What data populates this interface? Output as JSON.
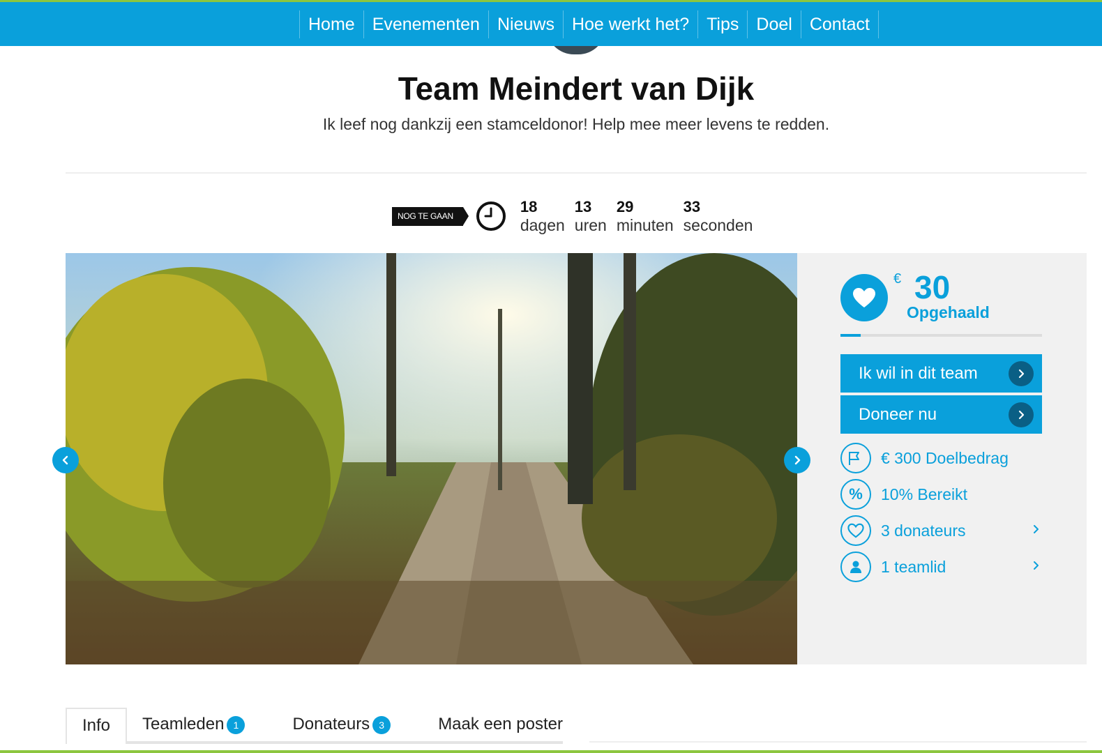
{
  "nav": {
    "items": [
      "Home",
      "Evenementen",
      "Nieuws",
      "Hoe werkt het?",
      "Tips",
      "Doel",
      "Contact"
    ]
  },
  "team": {
    "title": "Team Meindert van Dijk",
    "subtitle": "Ik leef nog dankzij een stamceldonor! Help mee meer levens te redden."
  },
  "countdown": {
    "badge": "NOG TE GAAN",
    "units": [
      {
        "value": "18",
        "label": "dagen"
      },
      {
        "value": "13",
        "label": "uren"
      },
      {
        "value": "29",
        "label": "minuten"
      },
      {
        "value": "33",
        "label": "seconden"
      }
    ]
  },
  "fundraising": {
    "currency": "€",
    "amount": "30",
    "raised_label": "Opgehaald",
    "progress_fraction": 0.1,
    "join_label": "Ik wil in dit team",
    "donate_label": "Doneer nu",
    "stats": {
      "goal": "€ 300 Doelbedrag",
      "reached": "10% Bereikt",
      "donors": "3 donateurs",
      "members": "1 teamlid"
    }
  },
  "tabs": {
    "info": "Info",
    "members": "Teamleden",
    "members_count": "1",
    "donors": "Donateurs",
    "donors_count": "3",
    "poster": "Maak een poster"
  },
  "colors": {
    "accent": "#0aa0db",
    "green": "#8cc63f"
  }
}
